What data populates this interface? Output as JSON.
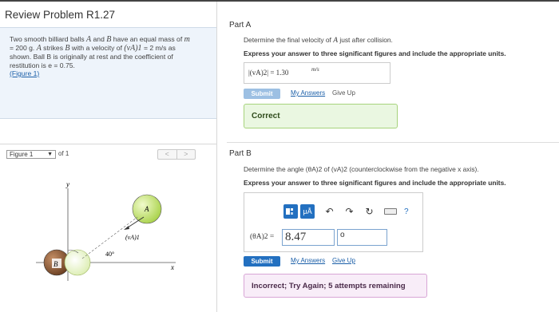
{
  "header": {
    "title": "Review Problem R1.27"
  },
  "problem": {
    "line1a": "Two smooth billiard balls ",
    "ball_a": "A",
    "line1b": " and ",
    "ball_b": "B",
    "line1c": " have an equal mass of ",
    "mass_var": "m",
    "line2": "= 200 g. ",
    "line2b": " strikes ",
    "line2c": " with a velocity of ",
    "vel_expr": "(vA)1",
    "vel_val": " = 2 m/s as",
    "line3": "shown. Ball B is originally at rest and the coefficient of",
    "line4": "restitution is e = 0.75.",
    "figure_link": "(Figure 1)"
  },
  "figure_nav": {
    "select_value": "Figure 1",
    "of_text": "of 1",
    "prev": "<",
    "next": ">"
  },
  "figure": {
    "y_label": "y",
    "x_label": "x",
    "ball_a_label": "A",
    "ball_b_label": "B",
    "velocity_label": "(vA)1",
    "angle_label": "40°",
    "colors": {
      "ball_a": "#cde97a",
      "ball_b_left": "#8b5a3c",
      "ball_b_right": "#e8f2c6"
    }
  },
  "part_a": {
    "label": "Part A",
    "question_pre": "Determine the final velocity of ",
    "question_var": "A",
    "question_post": " just after collision.",
    "instruction": "Express your answer to three significant figures and include the appropriate units.",
    "answer_expr": "|(vA)2| =  1.30",
    "answer_unit": "m/s",
    "submit_label": "Submit",
    "my_answers": "My Answers",
    "give_up": "Give Up",
    "feedback": "Correct"
  },
  "part_b": {
    "label": "Part B",
    "question": "Determine the angle (θA)2 of (vA)2 (counterclockwise from the negative x axis).",
    "instruction": "Express your answer to three significant figures and include the appropriate units.",
    "toolbar": {
      "units_button": "μÅ",
      "undo_icon": "↶",
      "redo_icon": "↷",
      "reset_icon": "↻",
      "help_icon": "?"
    },
    "eq_label": "(θA)2 =",
    "value": "8.47",
    "unit_value": "o",
    "submit_label": "Submit",
    "my_answers": "My Answers",
    "give_up": "Give Up",
    "feedback": "Incorrect; Try Again; 5 attempts remaining"
  }
}
